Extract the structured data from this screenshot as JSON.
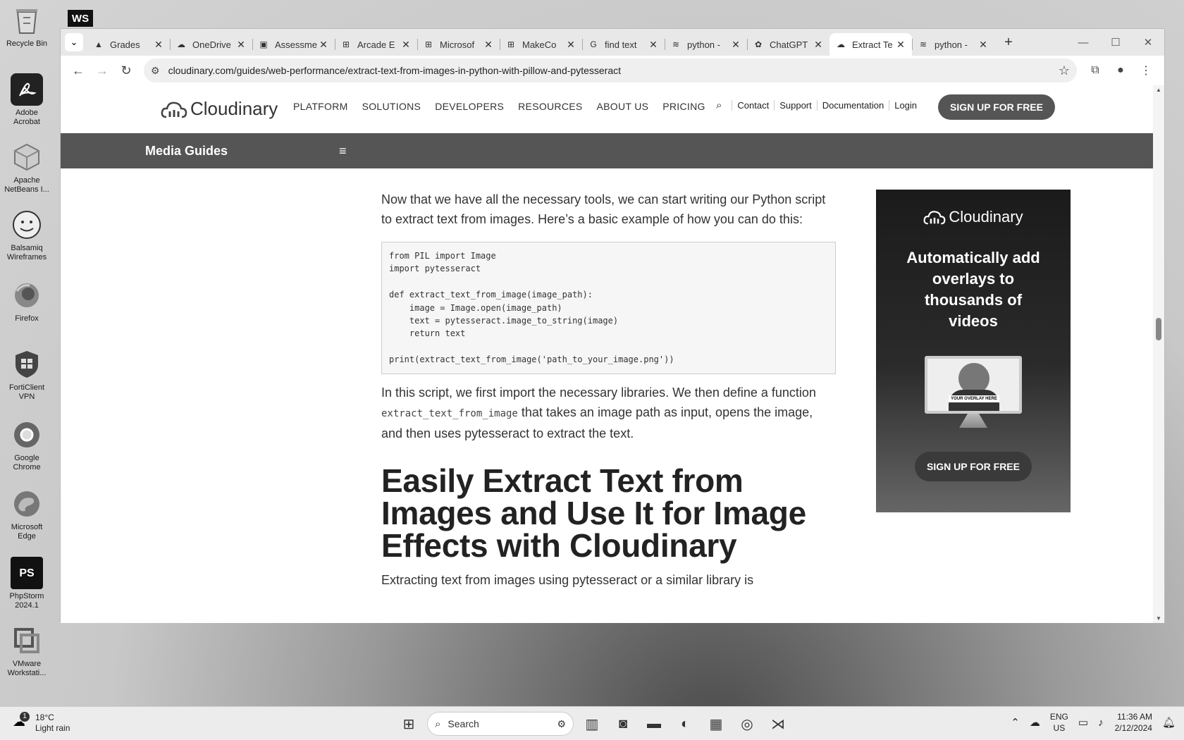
{
  "desktop": {
    "icons": [
      {
        "label": "Recycle Bin",
        "icon": "recycle-bin-icon"
      },
      {
        "label": "Adobe Acrobat",
        "icon": "acrobat-icon"
      },
      {
        "label": "Apache NetBeans I...",
        "icon": "netbeans-icon"
      },
      {
        "label": "Balsamiq Wireframes",
        "icon": "balsamiq-icon"
      },
      {
        "label": "Firefox",
        "icon": "firefox-icon"
      },
      {
        "label": "FortiClient VPN",
        "icon": "forticlient-icon"
      },
      {
        "label": "Google Chrome",
        "icon": "chrome-icon"
      },
      {
        "label": "Microsoft Edge",
        "icon": "edge-icon"
      },
      {
        "label": "PhpStorm 2024.1",
        "icon": "phpstorm-icon"
      },
      {
        "label": "VMware Workstati...",
        "icon": "vmware-icon"
      }
    ],
    "ws_badge": "WS"
  },
  "browser": {
    "tabs": [
      {
        "title": "Grades",
        "icon": "canvas-icon"
      },
      {
        "title": "OneDrive",
        "icon": "onedrive-icon"
      },
      {
        "title": "Assessme",
        "icon": "excel-icon"
      },
      {
        "title": "Arcade E",
        "icon": "arcade-icon"
      },
      {
        "title": "Microsof",
        "icon": "microsoft-icon"
      },
      {
        "title": "MakeCo",
        "icon": "makecode-icon"
      },
      {
        "title": "find text",
        "icon": "google-icon"
      },
      {
        "title": "python -",
        "icon": "stackoverflow-icon"
      },
      {
        "title": "ChatGPT",
        "icon": "chatgpt-icon"
      },
      {
        "title": "Extract Te",
        "icon": "cloudinary-icon",
        "active": true
      },
      {
        "title": "python -",
        "icon": "stackoverflow-icon"
      }
    ],
    "url": "cloudinary.com/guides/web-performance/extract-text-from-images-in-python-with-pillow-and-pytesseract"
  },
  "site": {
    "logo_text": "Cloudinary",
    "nav": [
      "PLATFORM",
      "SOLUTIONS",
      "DEVELOPERS",
      "RESOURCES",
      "ABOUT US",
      "PRICING"
    ],
    "util_links": [
      "Contact",
      "Support",
      "Documentation",
      "Login"
    ],
    "signup": "SIGN UP FOR FREE",
    "guides_title": "Media Guides"
  },
  "article": {
    "intro": "Now that we have all the necessary tools, we can start writing our Python script to extract text from images. Here’s a basic example of how you can do this:",
    "code": "from PIL import Image\nimport pytesseract\n\ndef extract_text_from_image(image_path):\n    image = Image.open(image_path)\n    text = pytesseract.image_to_string(image)\n    return text\n\nprint(extract_text_from_image('path_to_your_image.png'))",
    "explain_before": "In this script, we first import the necessary libraries. We then define a function ",
    "explain_code": "extract_text_from_image",
    "explain_after": " that takes an image path as input, opens the image, and then uses pytesseract to extract the text.",
    "heading": "Easily Extract Text from Images and Use It for Image Effects with Cloudinary",
    "next_para": "Extracting text from images using pytesseract or a similar library is"
  },
  "ad": {
    "logo_text": "Cloudinary",
    "tagline": "Automatically add overlays to thousands of videos",
    "overlay_text": "YOUR OVERLAY HERE",
    "button": "SIGN UP FOR FREE"
  },
  "taskbar": {
    "weather_badge": "1",
    "temperature": "18°C",
    "condition": "Light rain",
    "search_placeholder": "Search",
    "lang_top": "ENG",
    "lang_bottom": "US",
    "time": "11:36 AM",
    "date": "2/12/2024"
  }
}
